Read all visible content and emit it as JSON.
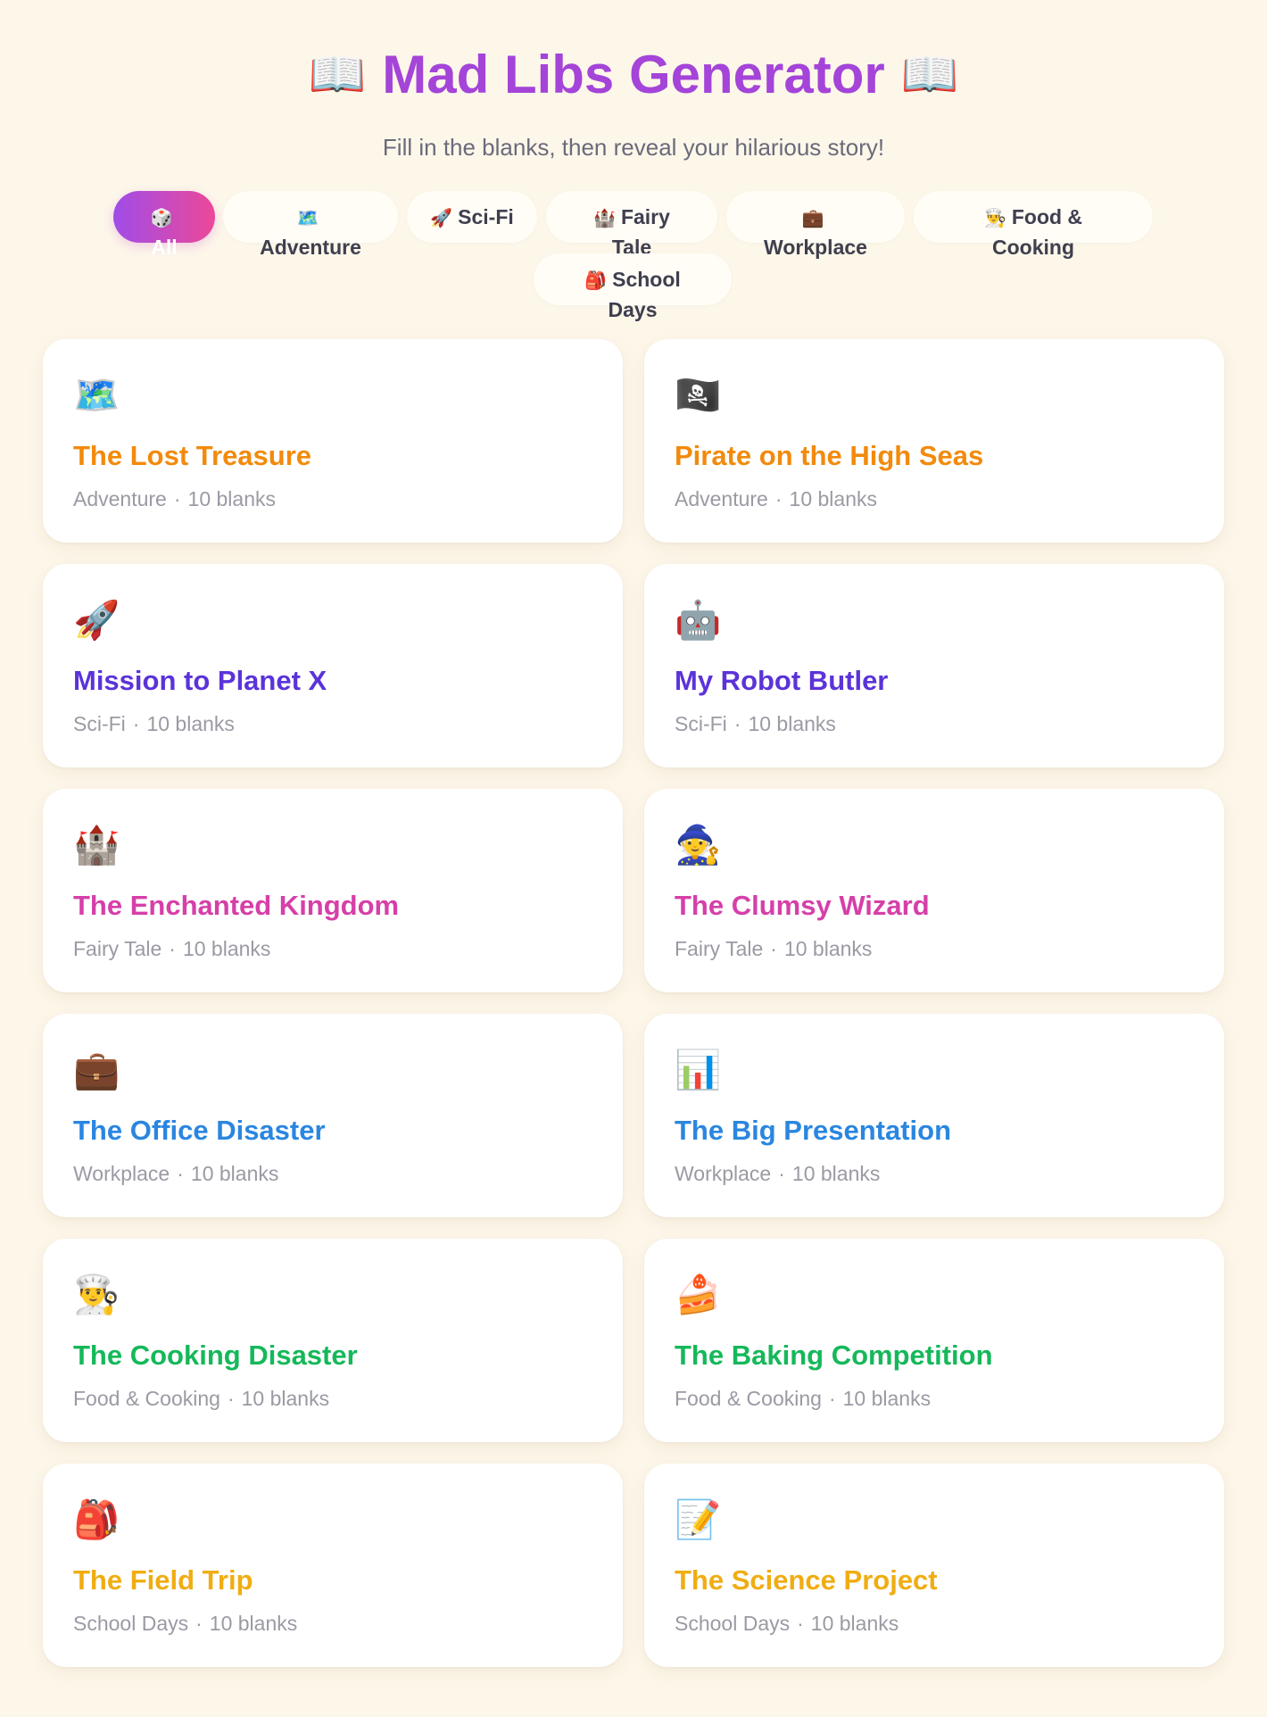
{
  "header": {
    "title": "Mad Libs Generator",
    "book_icon_left": "📖",
    "book_icon_right": "📖",
    "subtitle": "Fill in the blanks, then reveal your hilarious story!"
  },
  "filters": [
    {
      "icon": "🎲",
      "label": "All",
      "active": true
    },
    {
      "icon": "🗺️",
      "label": "Adventure"
    },
    {
      "icon": "🚀",
      "label": "Sci-Fi"
    },
    {
      "icon": "🏰",
      "label": "Fairy Tale"
    },
    {
      "icon": "💼",
      "label": "Workplace"
    },
    {
      "icon": "👨‍🍳",
      "label": "Food & Cooking"
    },
    {
      "icon": "🎒",
      "label": "School Days"
    }
  ],
  "colors": {
    "adventure": "#f28a0c",
    "scifi": "#5b33d9",
    "fairytale": "#d63fa8",
    "workplace": "#2a86e0",
    "food": "#15b85a",
    "school": "#f0ad12"
  },
  "stories": [
    {
      "icon": "🗺️",
      "title": "The Lost Treasure",
      "category": "Adventure",
      "blanks": "10 blanks"
    },
    {
      "icon": "🏴‍☠️",
      "title": "Pirate on the High Seas",
      "category": "Adventure",
      "blanks": "10 blanks"
    },
    {
      "icon": "🚀",
      "title": "Mission to Planet X",
      "category": "Sci-Fi",
      "blanks": "10 blanks"
    },
    {
      "icon": "🤖",
      "title": "My Robot Butler",
      "category": "Sci-Fi",
      "blanks": "10 blanks"
    },
    {
      "icon": "🏰",
      "title": "The Enchanted Kingdom",
      "category": "Fairy Tale",
      "blanks": "10 blanks"
    },
    {
      "icon": "🧙",
      "title": "The Clumsy Wizard",
      "category": "Fairy Tale",
      "blanks": "10 blanks"
    },
    {
      "icon": "💼",
      "title": "The Office Disaster",
      "category": "Workplace",
      "blanks": "10 blanks"
    },
    {
      "icon": "📊",
      "title": "The Big Presentation",
      "category": "Workplace",
      "blanks": "10 blanks"
    },
    {
      "icon": "👨‍🍳",
      "title": "The Cooking Disaster",
      "category": "Food & Cooking",
      "blanks": "10 blanks"
    },
    {
      "icon": "🍰",
      "title": "The Baking Competition",
      "category": "Food & Cooking",
      "blanks": "10 blanks"
    },
    {
      "icon": "🎒",
      "title": "The Field Trip",
      "category": "School Days",
      "blanks": "10 blanks"
    },
    {
      "icon": "📝",
      "title": "The Science Project",
      "category": "School Days",
      "blanks": "10 blanks"
    }
  ]
}
